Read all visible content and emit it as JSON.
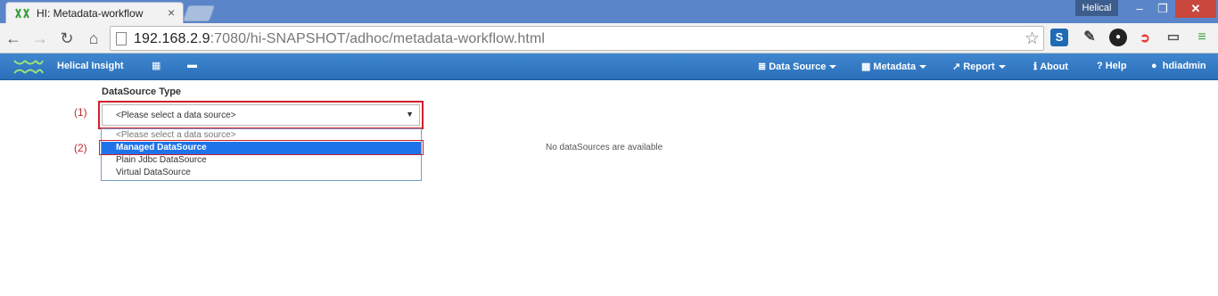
{
  "browser": {
    "tab_title": "HI: Metadata-workflow",
    "tab_close": "×",
    "profile_name": "Helical",
    "window_min": "–",
    "window_max": "❐",
    "window_close": "✕",
    "url_host": "192.168.2.9",
    "url_rest": ":7080/hi-SNAPSHOT/adhoc/metadata-workflow.html",
    "back_icon": "←",
    "forward_icon": "→",
    "reload_icon": "↻",
    "home_icon": "⌂",
    "star_icon": "☆",
    "ext_s": "S",
    "ext_dropper": "✎",
    "ext_cam": "●",
    "ext_red": "➲",
    "ext_cast": "▭",
    "ext_menu": "≡"
  },
  "appbar": {
    "brand": "Helical Insight",
    "grid_icon": "▦",
    "folder_icon": "▬",
    "menus": [
      {
        "icon": "≣",
        "label": "Data Source",
        "dropdown": true
      },
      {
        "icon": "▦",
        "label": "Metadata",
        "dropdown": true
      },
      {
        "icon": "↗",
        "label": "Report",
        "dropdown": true
      },
      {
        "icon": "ℹ",
        "label": "About",
        "dropdown": false
      },
      {
        "icon": "?",
        "label": "Help",
        "dropdown": false
      },
      {
        "icon": "●",
        "label": "hdiadmin",
        "dropdown": false
      }
    ]
  },
  "form": {
    "label": "DataSource Type",
    "annotation_1": "(1)",
    "annotation_2": "(2)",
    "selected_value": "<Please select a data source>",
    "arrow": "▼",
    "options": [
      "<Please select a data source>",
      "Managed DataSource",
      "Plain Jdbc DataSource",
      "Virtual DataSource"
    ],
    "highlighted_option_index": 1,
    "empty_message": "No dataSources are available"
  },
  "colors": {
    "titlebar": "#5a86c9",
    "appbar": "#2f78c4",
    "highlight": "#1e73e8",
    "annotation_red": "#d01f2a"
  }
}
